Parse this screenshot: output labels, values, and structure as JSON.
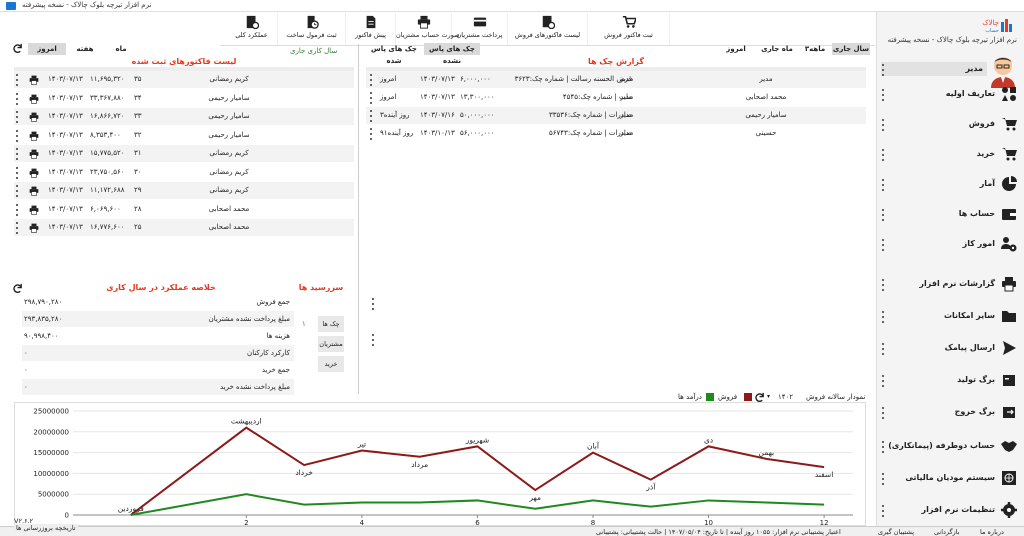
{
  "window": {
    "title": "نرم افزار تیرچه بلوک چالاک - نسخه پیشرفته"
  },
  "brand": {
    "logo_text": "چالاک",
    "logo_sub": "حساب",
    "app_name": "نرم افزار تیرچه بلوک چالاک - نسخه پیشرفته"
  },
  "user": {
    "name": "مدیر"
  },
  "menu": [
    {
      "label": "تعاریف اولیه",
      "icon": "shapes-icon"
    },
    {
      "label": "فروش",
      "icon": "cart-icon"
    },
    {
      "label": "خرید",
      "icon": "cart-icon"
    },
    {
      "label": "آمار",
      "icon": "pie-chart-icon"
    },
    {
      "label": "حساب ها",
      "icon": "wallet-icon"
    },
    {
      "label": "امور کاز",
      "icon": "users-gear-icon"
    },
    {
      "label": "گزارشات نرم افزار",
      "icon": "printer-icon"
    },
    {
      "label": "سایر امکانات",
      "icon": "folder-icon"
    },
    {
      "label": "ارسال پیامک",
      "icon": "send-icon"
    },
    {
      "label": "برگ تولید",
      "icon": "box-icon"
    },
    {
      "label": "برگ خروج",
      "icon": "exit-icon"
    },
    {
      "label": "حساب دوطرفه (پیمانکاری)",
      "icon": "handshake-icon"
    },
    {
      "label": "سیستم مودیان مالیاتی",
      "icon": "globe-icon"
    },
    {
      "label": "تنظیمات نرم افزار",
      "icon": "gear-icon"
    }
  ],
  "toolbar": [
    {
      "label": "ثبت فاکتور فروش",
      "icon": "cart-icon"
    },
    {
      "label": "لیست فاکتورهای فروش",
      "icon": "invoice-list-icon"
    },
    {
      "label": "پرداخت مشتریان",
      "icon": "card-icon"
    },
    {
      "label": "صورت حساب مشتریان",
      "icon": "printer-icon"
    },
    {
      "label": "پیش فاکتور",
      "icon": "document-icon"
    },
    {
      "label": "ثبت فرمول ساخت",
      "icon": "formula-icon"
    },
    {
      "label": "عملکرد کلی",
      "icon": "report-icon"
    }
  ],
  "invoices": {
    "title": "لیست فاکتورهای ثبت شده",
    "fiscal_label": "سال کاری جاری",
    "tabs": [
      "ماه",
      "هفته",
      "امروز"
    ],
    "rows": [
      {
        "name": "کریم رمضانی",
        "no": "۳۵",
        "amount": "۱۱,۶۹۵,۳۲۰",
        "date": "۱۴۰۳/۰۷/۱۳"
      },
      {
        "name": "سامیار رحیمی",
        "no": "۳۴",
        "amount": "۳۳,۳۶۷,۸۸۰",
        "date": "۱۴۰۳/۰۷/۱۳"
      },
      {
        "name": "سامیار رحیمی",
        "no": "۳۳",
        "amount": "۱۶,۸۶۶,۷۲۰",
        "date": "۱۴۰۳/۰۷/۱۳"
      },
      {
        "name": "سامیار رحیمی",
        "no": "۳۲",
        "amount": "۸,۳۵۳,۴۰۰",
        "date": "۱۴۰۳/۰۷/۱۳"
      },
      {
        "name": "کریم رمضانی",
        "no": "۳۱",
        "amount": "۱۵,۷۷۵,۵۲۰",
        "date": "۱۴۰۳/۰۷/۱۳"
      },
      {
        "name": "کریم رمضانی",
        "no": "۳۰",
        "amount": "۲۳,۷۵۰,۵۶۰",
        "date": "۱۴۰۳/۰۷/۱۳"
      },
      {
        "name": "کریم رمضانی",
        "no": "۲۹",
        "amount": "۱۱,۱۷۲,۶۸۸",
        "date": "۱۴۰۳/۰۷/۱۳"
      },
      {
        "name": "محمد اصحابی",
        "no": "۲۸",
        "amount": "۶,۰۶۹,۶۰۰",
        "date": "۱۴۰۳/۰۷/۱۳"
      },
      {
        "name": "محمد اصحابی",
        "no": "۲۵",
        "amount": "۱۶,۷۷۶,۶۰۰",
        "date": "۱۴۰۳/۰۷/۱۳"
      }
    ]
  },
  "checks": {
    "title": "گزارش چک ها",
    "tabs_left": [
      "چک های پاس نشده",
      "چک های پاس شده"
    ],
    "tabs_right": [
      "سال جاری",
      "۳ماهه",
      "ماه جاری",
      "امروز"
    ],
    "rows": [
      {
        "person": "مدیر",
        "customer": "مدیر",
        "desc": "قرض الحسنه رسالت | شماره چک:۳۶۲۳",
        "amount": "۶,۰۰۰,۰۰۰",
        "date": "۱۴۰۳/۰۷/۱۳",
        "status": "امروز"
      },
      {
        "person": "مدیر",
        "customer": "محمد اصحابی",
        "desc": "ملت | شماره چک:۴۵۴۵",
        "amount": "۱۳,۳۰۰,۰۰۰",
        "date": "۱۴۰۳/۰۷/۱۳",
        "status": "امروز"
      },
      {
        "person": "مدیر",
        "customer": "سامیار رحیمی",
        "desc": "صادرات | شماره چک:۳۳۵۳۶",
        "amount": "۵۰,۰۰۰,۰۰۰",
        "date": "۱۴۰۳/۰۷/۱۶",
        "status": "۳روز آینده"
      },
      {
        "person": "مدیر",
        "customer": "حسینی",
        "desc": "صادرات | شماره چک:۵۶۷۴۳",
        "amount": "۵۶,۰۰۰,۰۰۰",
        "date": "۱۴۰۳/۱۰/۱۳",
        "status": "۹۱روز آینده"
      }
    ]
  },
  "summary": {
    "title": "خلاصه عملکرد در سال کاری",
    "rows": [
      {
        "label": "جمع فروش",
        "value": "۲۹۸,۷۹۰,۲۸۰"
      },
      {
        "label": "مبلغ پرداخت نشده مشتریان",
        "value": "۲۹۳,۸۳۵,۲۸۰"
      },
      {
        "label": "هزینه ها",
        "value": "۹۰,۹۹۸,۴۰۰"
      },
      {
        "label": "کارکرد کارکنان",
        "value": "۰"
      },
      {
        "label": "جمع خرید",
        "value": "۰"
      },
      {
        "label": "مبلغ پرداخت نشده خرید",
        "value": "۰"
      }
    ]
  },
  "due": {
    "title": "سررسید ها",
    "buttons": [
      "چک ها",
      "مشتریان",
      "خرید"
    ],
    "count": "۱"
  },
  "chart_header": {
    "label": "نمودار سالانه فروش",
    "year": "۱۴۰۲",
    "legend": [
      {
        "name": "فروش",
        "color": "#8b1a1a"
      },
      {
        "name": "درآمد ها",
        "color": "#1e8a1e"
      }
    ]
  },
  "chart_data": {
    "type": "line",
    "x": [
      0,
      2,
      3,
      4,
      5,
      6,
      7,
      8,
      9,
      10,
      11,
      12
    ],
    "month_labels": [
      "فروردین",
      "اردیبهشت",
      "خرداد",
      "تیر",
      "مرداد",
      "شهریور",
      "مهر",
      "آبان",
      "آذر",
      "دی",
      "بهمن",
      "اسفند"
    ],
    "series": [
      {
        "name": "فروش",
        "color": "#8b1a1a",
        "values": [
          0,
          21000000,
          12000000,
          15500000,
          14000000,
          16500000,
          6000000,
          15000000,
          8500000,
          16500000,
          13500000,
          11500000
        ]
      },
      {
        "name": "درآمد ها",
        "color": "#1e8a1e",
        "values": [
          0,
          5000000,
          2500000,
          3000000,
          3000000,
          3500000,
          1500000,
          3500000,
          2000000,
          3500000,
          3000000,
          2500000
        ]
      }
    ],
    "xticks": [
      2,
      4,
      6,
      8,
      10,
      12
    ],
    "yticks": [
      0,
      5000000,
      10000000,
      15000000,
      20000000,
      25000000
    ],
    "ytick_labels": [
      "0",
      "5000000",
      "10000000",
      "15000000",
      "20000000",
      "25000000"
    ],
    "ylim": [
      0,
      25000000
    ],
    "xlim": [
      -1,
      12.5
    ]
  },
  "status": {
    "about": "درباره ما",
    "backup": "بازگردانی",
    "support": "پشتیبان گیری",
    "support_info": "اعتبار پشتیبانی نرم افزار: ۱۰۵۵ روز آینده | تا تاریخ: ۱۴۰۷/۰۵/۰۴ | حالت پشتیبانی: پشتیبانی",
    "version": "V۲.۶.۲",
    "update_history": "تاریخچه بروزرسانی ها"
  }
}
